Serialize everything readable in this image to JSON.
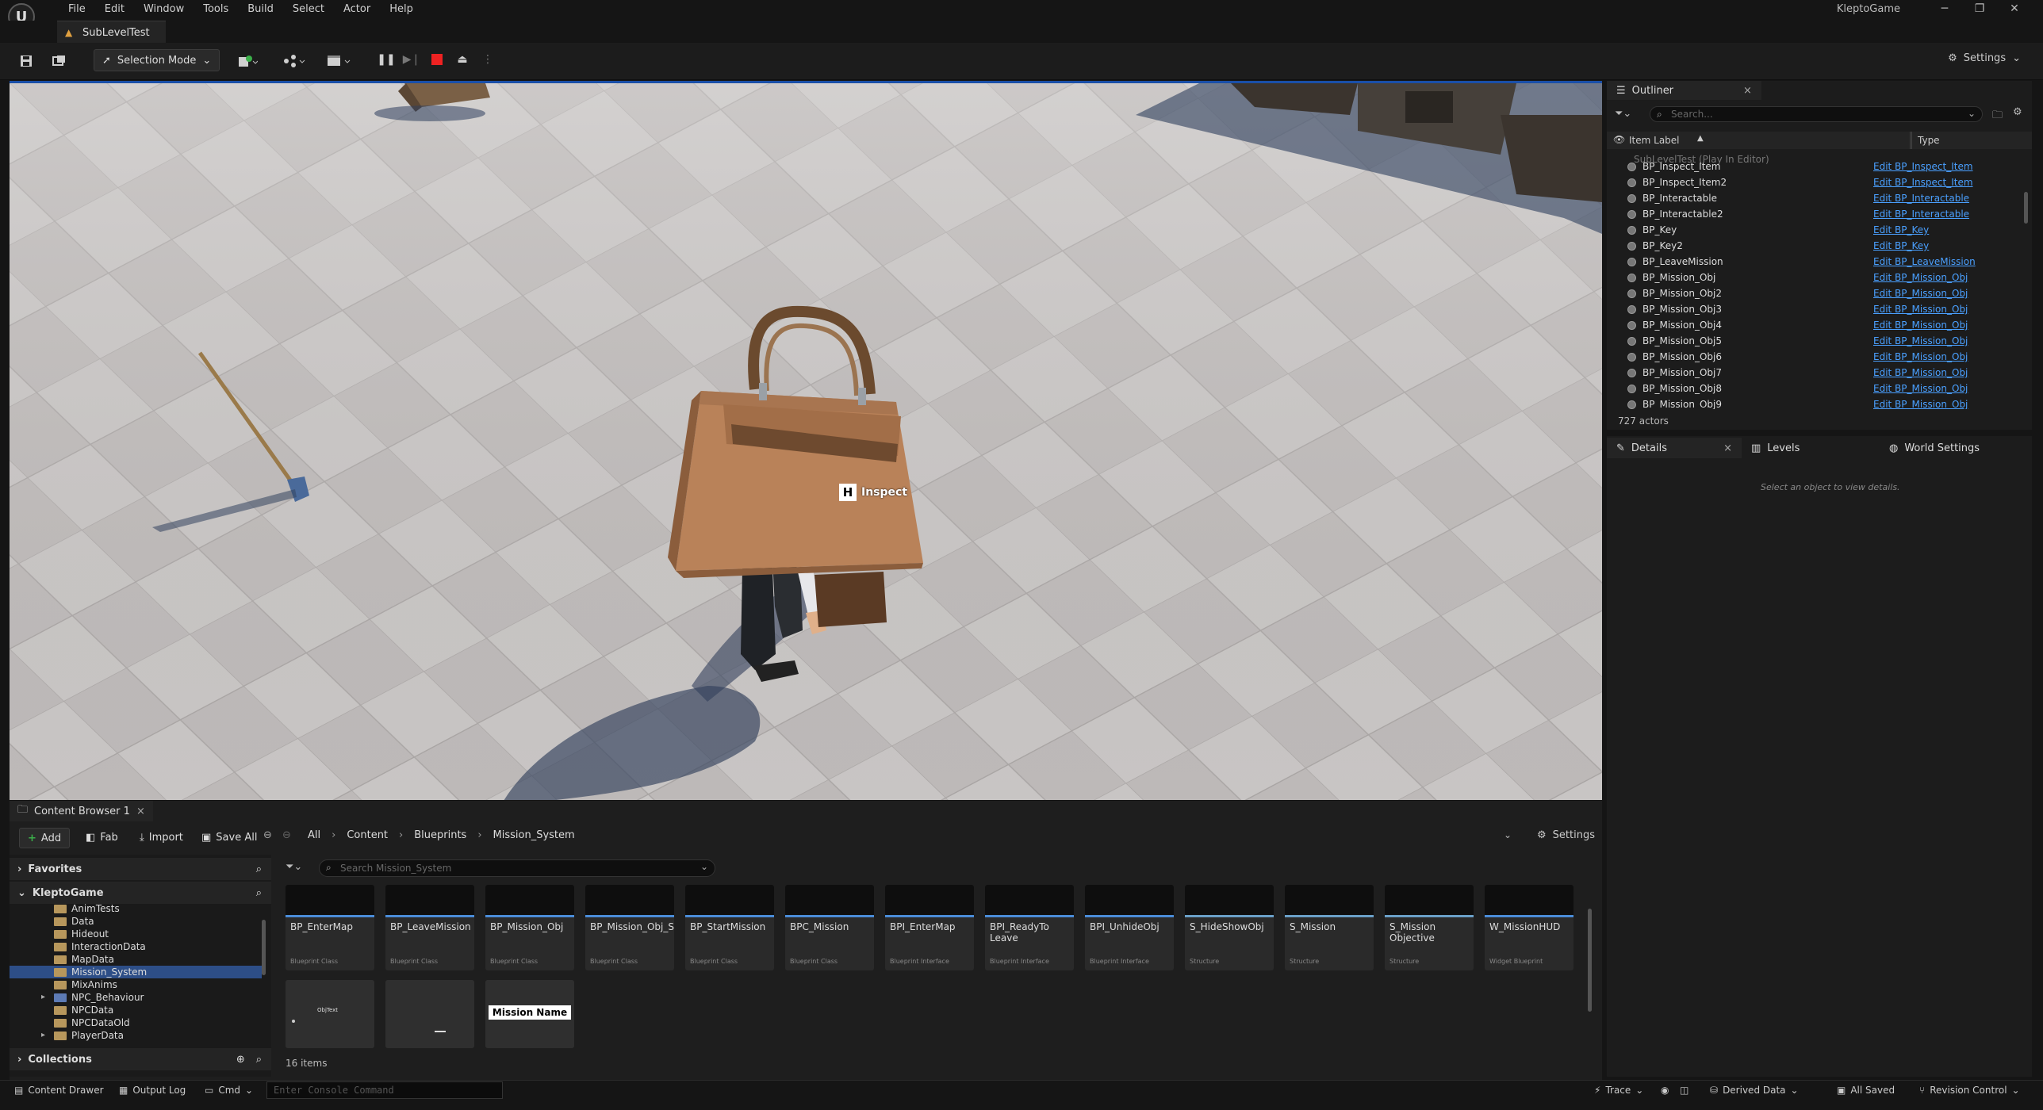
{
  "menu": [
    "File",
    "Edit",
    "Window",
    "Tools",
    "Build",
    "Select",
    "Actor",
    "Help"
  ],
  "app_title": "KleptoGame",
  "doc_tab": "SubLevelTest",
  "toolbar": {
    "selection_mode": "Selection Mode",
    "settings": "Settings"
  },
  "viewport": {
    "prompt_key": "H",
    "prompt_label": "Inspect"
  },
  "outliner": {
    "tab_label": "Outliner",
    "search_placeholder": "Search...",
    "col_label": "Item Label",
    "col_type": "Type",
    "root": "SubLevelTest (Play In Editor)",
    "rows": [
      {
        "label": "BP_Inspect_Item",
        "type": "Edit BP_Inspect_Item"
      },
      {
        "label": "BP_Inspect_Item2",
        "type": "Edit BP_Inspect_Item"
      },
      {
        "label": "BP_Interactable",
        "type": "Edit BP_Interactable"
      },
      {
        "label": "BP_Interactable2",
        "type": "Edit BP_Interactable"
      },
      {
        "label": "BP_Key",
        "type": "Edit BP_Key"
      },
      {
        "label": "BP_Key2",
        "type": "Edit BP_Key"
      },
      {
        "label": "BP_LeaveMission",
        "type": "Edit BP_LeaveMission"
      },
      {
        "label": "BP_Mission_Obj",
        "type": "Edit BP_Mission_Obj"
      },
      {
        "label": "BP_Mission_Obj2",
        "type": "Edit BP_Mission_Obj"
      },
      {
        "label": "BP_Mission_Obj3",
        "type": "Edit BP_Mission_Obj"
      },
      {
        "label": "BP_Mission_Obj4",
        "type": "Edit BP_Mission_Obj"
      },
      {
        "label": "BP_Mission_Obj5",
        "type": "Edit BP_Mission_Obj"
      },
      {
        "label": "BP_Mission_Obj6",
        "type": "Edit BP_Mission_Obj"
      },
      {
        "label": "BP_Mission_Obj7",
        "type": "Edit BP_Mission_Obj"
      },
      {
        "label": "BP_Mission_Obj8",
        "type": "Edit BP_Mission_Obj"
      },
      {
        "label": "BP_Mission_Obj9",
        "type": "Edit BP_Mission_Obj"
      }
    ],
    "actor_count": "727 actors"
  },
  "details": {
    "tab_details": "Details",
    "tab_levels": "Levels",
    "tab_world": "World Settings",
    "empty_msg": "Select an object to view details."
  },
  "content_browser": {
    "tab_label": "Content Browser 1",
    "add": "Add",
    "fab": "Fab",
    "import": "Import",
    "save_all": "Save All",
    "breadcrumb": [
      "All",
      "Content",
      "Blueprints",
      "Mission_System"
    ],
    "settings": "Settings",
    "favorites": "Favorites",
    "project": "KleptoGame",
    "collections": "Collections",
    "search_placeholder": "Search Mission_System",
    "tree": [
      {
        "label": "AnimTests",
        "blue": false,
        "sel": false,
        "arrow": false
      },
      {
        "label": "Data",
        "blue": false,
        "sel": false,
        "arrow": false
      },
      {
        "label": "Hideout",
        "blue": false,
        "sel": false,
        "arrow": false
      },
      {
        "label": "InteractionData",
        "blue": false,
        "sel": false,
        "arrow": false
      },
      {
        "label": "MapData",
        "blue": false,
        "sel": false,
        "arrow": false
      },
      {
        "label": "Mission_System",
        "blue": false,
        "sel": true,
        "arrow": false
      },
      {
        "label": "MixAnims",
        "blue": false,
        "sel": false,
        "arrow": false
      },
      {
        "label": "NPC_Behaviour",
        "blue": true,
        "sel": false,
        "arrow": true
      },
      {
        "label": "NPCData",
        "blue": false,
        "sel": false,
        "arrow": false
      },
      {
        "label": "NPCDataOld",
        "blue": false,
        "sel": false,
        "arrow": false
      },
      {
        "label": "PlayerData",
        "blue": false,
        "sel": false,
        "arrow": true
      }
    ],
    "assets": [
      {
        "name": "BP_EnterMap",
        "type": "Blueprint Class",
        "bar": "#4a8cd8"
      },
      {
        "name": "BP_LeaveMission",
        "type": "Blueprint Class",
        "bar": "#4a8cd8"
      },
      {
        "name": "BP_Mission_Obj",
        "type": "Blueprint Class",
        "bar": "#4a8cd8"
      },
      {
        "name": "BP_Mission_Obj_S",
        "type": "Blueprint Class",
        "bar": "#4a8cd8"
      },
      {
        "name": "BP_StartMission",
        "type": "Blueprint Class",
        "bar": "#4a8cd8"
      },
      {
        "name": "BPC_Mission",
        "type": "Blueprint Class",
        "bar": "#4a8cd8"
      },
      {
        "name": "BPI_EnterMap",
        "type": "Blueprint Interface",
        "bar": "#4a8cd8"
      },
      {
        "name": "BPI_ReadyTo Leave",
        "type": "Blueprint Interface",
        "bar": "#4a8cd8"
      },
      {
        "name": "BPI_UnhideObj",
        "type": "Blueprint Interface",
        "bar": "#4a8cd8"
      },
      {
        "name": "S_HideShowObj",
        "type": "Structure",
        "bar": "#6aa0c8"
      },
      {
        "name": "S_Mission",
        "type": "Structure",
        "bar": "#6aa0c8"
      },
      {
        "name": "S_Mission Objective",
        "type": "Structure",
        "bar": "#6aa0c8"
      },
      {
        "name": "W_MissionHUD",
        "type": "Widget Blueprint",
        "bar": "#4a8cd8"
      }
    ],
    "row2_asset_text": "Mission Name",
    "row2_small_text": "ObjText",
    "items_count": "16 items"
  },
  "statusbar": {
    "content_drawer": "Content Drawer",
    "output_log": "Output Log",
    "cmd": "Cmd",
    "console_placeholder": "Enter Console Command",
    "trace": "Trace",
    "derived_data": "Derived Data",
    "all_saved": "All Saved",
    "revision_control": "Revision Control"
  }
}
